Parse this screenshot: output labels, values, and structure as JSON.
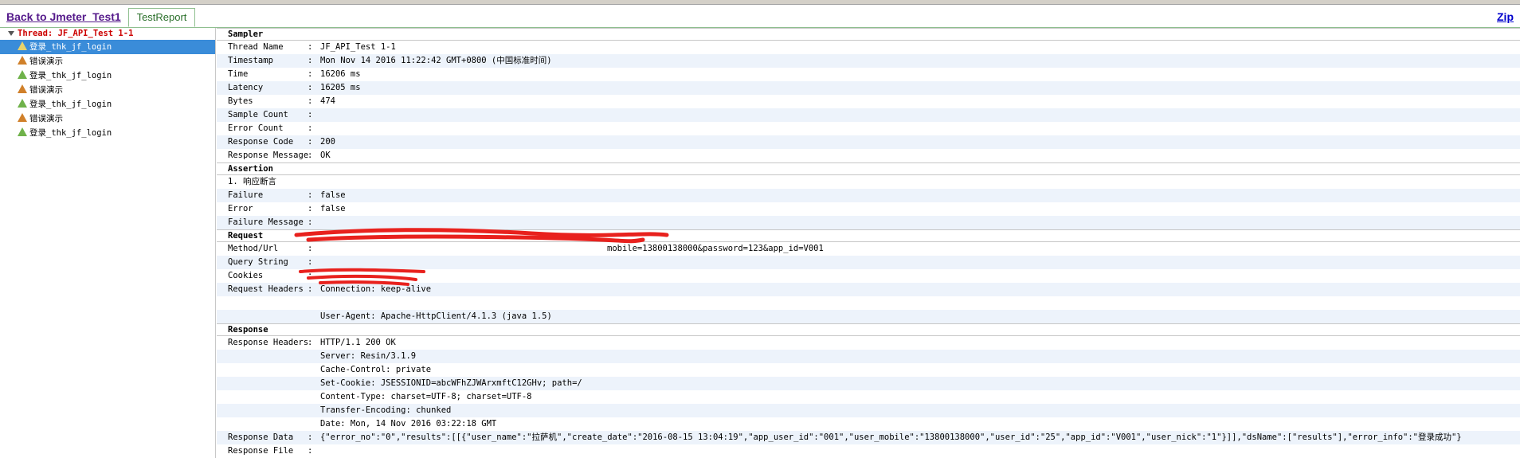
{
  "header": {
    "back_label": "Back to Jmeter_Test1",
    "tab_label": "TestReport",
    "zip_label": "Zip"
  },
  "sidebar": {
    "thread_label": "Thread: JF_API_Test 1-1",
    "items": [
      {
        "label": "登录_thk_jf_login",
        "status": "selected"
      },
      {
        "label": "错误演示",
        "status": "fail"
      },
      {
        "label": "登录_thk_jf_login",
        "status": "ok"
      },
      {
        "label": "错误演示",
        "status": "fail"
      },
      {
        "label": "登录_thk_jf_login",
        "status": "ok"
      },
      {
        "label": "错误演示",
        "status": "fail"
      },
      {
        "label": "登录_thk_jf_login",
        "status": "ok"
      }
    ]
  },
  "sampler": {
    "title": "Sampler",
    "rows": [
      {
        "k": "Thread Name",
        "v": "JF_API_Test 1-1"
      },
      {
        "k": "Timestamp",
        "v": "Mon Nov 14 2016 11:22:42 GMT+0800 (中国标准时间)"
      },
      {
        "k": "Time",
        "v": "16206 ms"
      },
      {
        "k": "Latency",
        "v": "16205 ms"
      },
      {
        "k": "Bytes",
        "v": "474"
      },
      {
        "k": "Sample Count",
        "v": ""
      },
      {
        "k": "Error Count",
        "v": ""
      },
      {
        "k": "Response Code",
        "v": "200"
      },
      {
        "k": "Response Message",
        "v": "OK"
      }
    ]
  },
  "assertion": {
    "title": "Assertion",
    "name": "1. 响应断言",
    "rows": [
      {
        "k": "Failure",
        "v": "false"
      },
      {
        "k": "Error",
        "v": "false"
      },
      {
        "k": "Failure Message",
        "v": ""
      }
    ]
  },
  "request": {
    "title": "Request",
    "rows": [
      {
        "k": "Method/Url",
        "v": "mobile=13800138000&password=123&app_id=V001"
      },
      {
        "k": "Query String",
        "v": ""
      },
      {
        "k": "Cookies",
        "v": ""
      },
      {
        "k": "Request Headers",
        "v": "Connection: keep-alive"
      },
      {
        "k": "",
        "v": ""
      },
      {
        "k": "",
        "v": "User-Agent: Apache-HttpClient/4.1.3 (java 1.5)"
      }
    ]
  },
  "response": {
    "title": "Response",
    "rows": [
      {
        "k": "Response Headers",
        "v": "HTTP/1.1 200 OK"
      },
      {
        "k": "",
        "v": "Server: Resin/3.1.9"
      },
      {
        "k": "",
        "v": "Cache-Control: private"
      },
      {
        "k": "",
        "v": "Set-Cookie: JSESSIONID=abcWFhZJWArxmftC12GHv; path=/"
      },
      {
        "k": "",
        "v": "Content-Type: charset=UTF-8; charset=UTF-8"
      },
      {
        "k": "",
        "v": "Transfer-Encoding: chunked"
      },
      {
        "k": "",
        "v": "Date: Mon, 14 Nov 2016 03:22:18 GMT"
      },
      {
        "k": "Response Data",
        "v": "{\"error_no\":\"0\",\"results\":[[{\"user_name\":\"拉萨机\",\"create_date\":\"2016-08-15 13:04:19\",\"app_user_id\":\"001\",\"user_mobile\":\"13800138000\",\"user_id\":\"25\",\"app_id\":\"V001\",\"user_nick\":\"1\"}]],\"dsName\":[\"results\"],\"error_info\":\"登录成功\"}"
      },
      {
        "k": "Response File",
        "v": ""
      }
    ]
  },
  "colors": {
    "accent": "#3a8cd9",
    "thread": "#cc0000",
    "scribble": "#e8211d"
  }
}
